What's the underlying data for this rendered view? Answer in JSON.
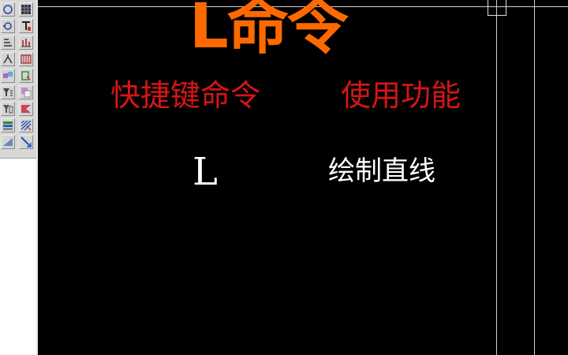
{
  "toolbar": {
    "column1": [
      "circle-icon",
      "arc-icon",
      "offset-icon",
      "extend-icon",
      "block-icon",
      "filter-icon",
      "table-icon",
      "layer-icon",
      "fill-icon"
    ],
    "column2": [
      "grid-icon",
      "text-style-icon",
      "dimension-icon",
      "array-icon",
      "select-icon",
      "copy-icon",
      "mirror-icon",
      "hatch-icon",
      "stretch-icon"
    ]
  },
  "slide": {
    "title": "L命令",
    "header_shortcut": "快捷键命令",
    "header_function": "使用功能",
    "command_key": "L",
    "command_function": "绘制直线"
  },
  "colors": {
    "background": "#000000",
    "title": "#ff6a00",
    "header": "#d61515",
    "body_text": "#ffffff"
  }
}
